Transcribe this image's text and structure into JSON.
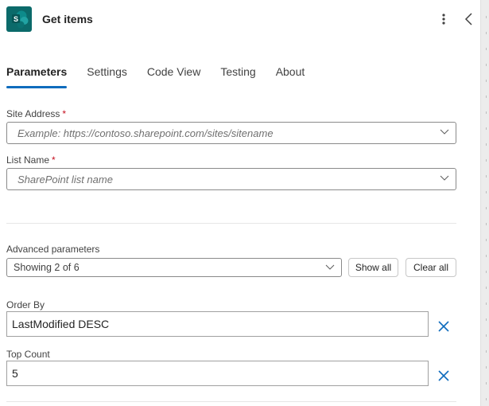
{
  "header": {
    "app_icon": "sharepoint-icon",
    "app_icon_letter": "S",
    "title": "Get items",
    "more_icon": "more-vertical-icon",
    "collapse_icon": "chevron-left-icon"
  },
  "tabs": [
    {
      "label": "Parameters",
      "active": true
    },
    {
      "label": "Settings",
      "active": false
    },
    {
      "label": "Code View",
      "active": false
    },
    {
      "label": "Testing",
      "active": false
    },
    {
      "label": "About",
      "active": false
    }
  ],
  "fields": {
    "site_address": {
      "label": "Site Address",
      "required_mark": "*",
      "placeholder": "Example: https://contoso.sharepoint.com/sites/sitename",
      "value": ""
    },
    "list_name": {
      "label": "List Name",
      "required_mark": "*",
      "placeholder": "SharePoint list name",
      "value": ""
    }
  },
  "advanced": {
    "label": "Advanced parameters",
    "selected": "Showing 2 of 6",
    "show_all_label": "Show all",
    "clear_all_label": "Clear all"
  },
  "advanced_fields": [
    {
      "label": "Order By",
      "value": "LastModified DESC"
    },
    {
      "label": "Top Count",
      "value": "5"
    }
  ],
  "colors": {
    "accent": "#0f6cbd",
    "required": "#c50f1f",
    "app_icon_bg": "#0b6a6a"
  }
}
